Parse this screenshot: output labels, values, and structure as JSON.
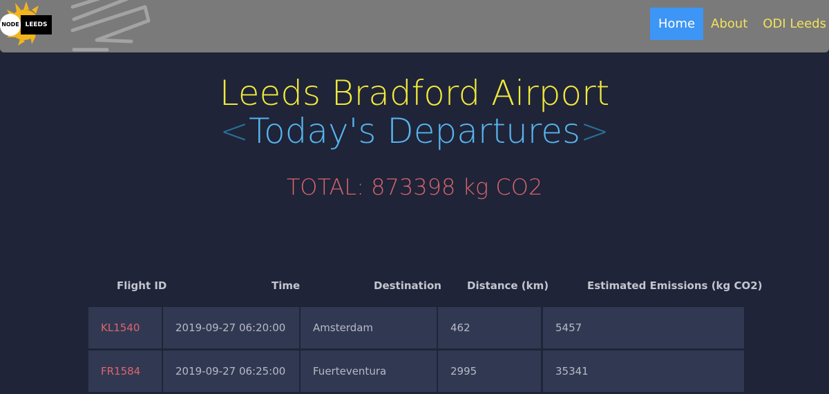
{
  "navbar": {
    "logo": {
      "text_left": "NODE",
      "text_right": "LEEDS",
      "icon": "node-leeds-logo"
    },
    "links": [
      {
        "label": "Home",
        "active": true
      },
      {
        "label": "About",
        "active": false
      },
      {
        "label": "ODI Leeds",
        "active": false
      }
    ]
  },
  "header": {
    "title": "Leeds Bradford Airport",
    "subtitle_open": "<",
    "subtitle": "Today's Departures",
    "subtitle_close": ">",
    "total": "TOTAL: 873398 kg CO2"
  },
  "table": {
    "columns": [
      "Flight ID",
      "Time",
      "Destination",
      "Distance (km)",
      "Estimated Emissions (kg CO2)"
    ],
    "rows": [
      {
        "flight": "KL1540",
        "time": "2019-09-27 06:20:00",
        "destination": "Amsterdam",
        "distance": "462",
        "emissions": "5457"
      },
      {
        "flight": "FR1584",
        "time": "2019-09-27 06:25:00",
        "destination": "Fuerteventura",
        "distance": "2995",
        "emissions": "35341"
      }
    ]
  },
  "colors": {
    "background": "#1f2438",
    "navbar": "#7a7a7a",
    "title": "#f2e93c",
    "subtitle": "#57b4ee",
    "total": "#d9646e",
    "active_link": "#3d95f5",
    "row_bg": "#313952"
  }
}
